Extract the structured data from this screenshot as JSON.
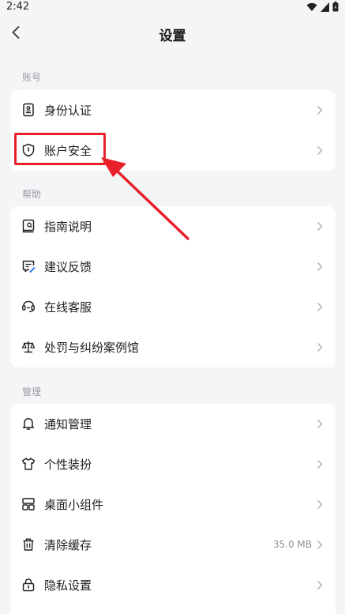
{
  "status": {
    "time": "2:42"
  },
  "header": {
    "title": "设置"
  },
  "sections": {
    "account": {
      "label": "账号",
      "items": [
        {
          "label": "身份认证",
          "icon": "id-card-icon"
        },
        {
          "label": "账户安全",
          "icon": "shield-icon"
        }
      ]
    },
    "help": {
      "label": "帮助",
      "items": [
        {
          "label": "指南说明",
          "icon": "guide-book-icon"
        },
        {
          "label": "建议反馈",
          "icon": "feedback-edit-icon"
        },
        {
          "label": "在线客服",
          "icon": "headset-icon"
        },
        {
          "label": "处罚与纠纷案例馆",
          "icon": "scales-icon"
        }
      ]
    },
    "manage": {
      "label": "管理",
      "items": [
        {
          "label": "通知管理",
          "icon": "bell-icon"
        },
        {
          "label": "个性装扮",
          "icon": "tshirt-icon"
        },
        {
          "label": "桌面小组件",
          "icon": "widget-grid-icon"
        },
        {
          "label": "清除缓存",
          "icon": "trash-icon",
          "value": "35.0 MB"
        },
        {
          "label": "隐私设置",
          "icon": "lock-icon"
        }
      ]
    }
  },
  "colors": {
    "background": "#f4f5f7",
    "card": "#ffffff",
    "annotation": "#e8202a"
  }
}
